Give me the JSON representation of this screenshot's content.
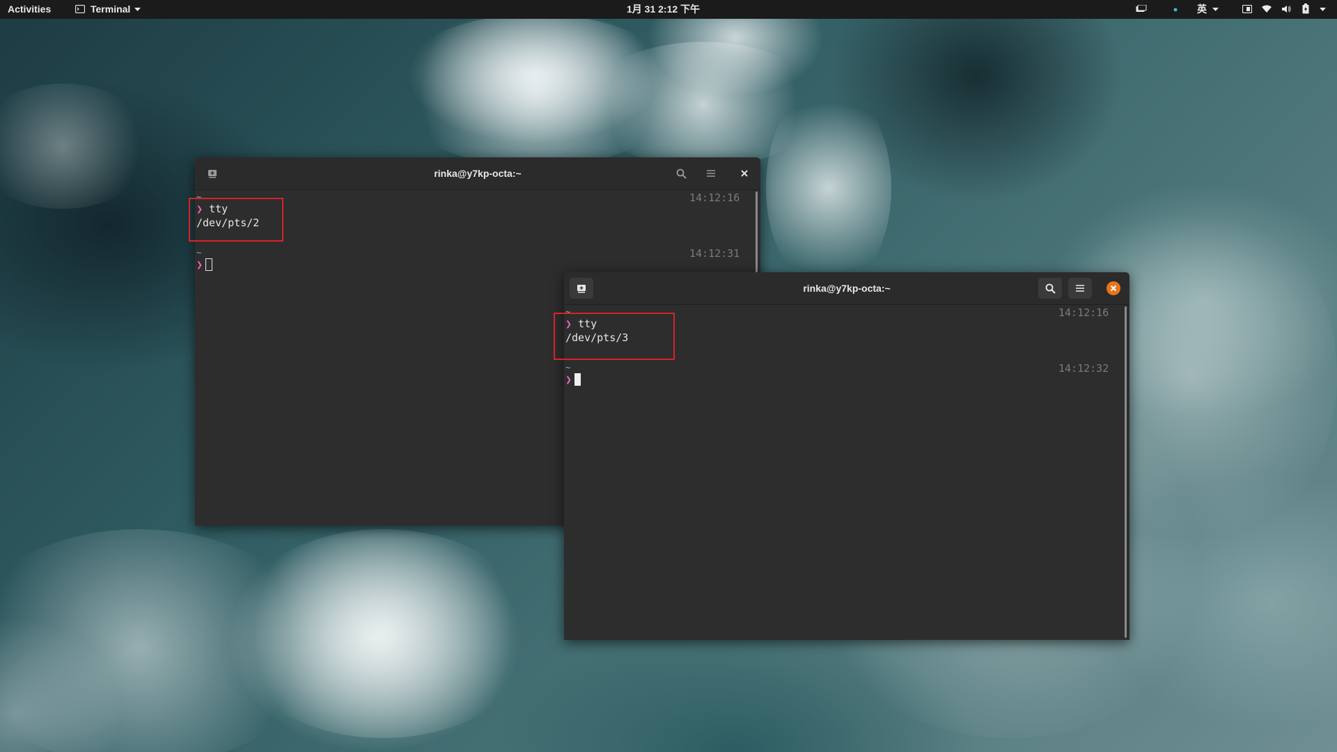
{
  "topbar": {
    "activities": "Activities",
    "app_menu": "Terminal",
    "clock": "1月 31  2:12 下午",
    "input_method": "英"
  },
  "window_back": {
    "title": "rinka@y7kp-octa:~",
    "lines": {
      "tilde1": "~",
      "cmd": "tty",
      "output": "/dev/pts/2",
      "tilde2": "~"
    },
    "time1": "14:12:16",
    "time2": "14:12:31",
    "prompt_glyph": "❯"
  },
  "window_front": {
    "title": "rinka@y7kp-octa:~",
    "lines": {
      "tilde1": "~",
      "cmd": "tty",
      "output": "/dev/pts/3",
      "tilde2": "~"
    },
    "time1": "14:12:16",
    "time2": "14:12:32",
    "prompt_glyph": "❯"
  },
  "colors": {
    "prompt": "#e66ab4",
    "tilde": "#62c6d6",
    "highlight_box": "#d8232a",
    "close_button_active": "#e8751a"
  },
  "icons": [
    "terminal-icon",
    "dropdown-arrow-icon",
    "screen-icon",
    "activity-dot-icon",
    "window-icon",
    "wifi-icon",
    "volume-icon",
    "battery-icon",
    "new-tab-icon",
    "search-icon",
    "menu-icon",
    "close-icon"
  ]
}
